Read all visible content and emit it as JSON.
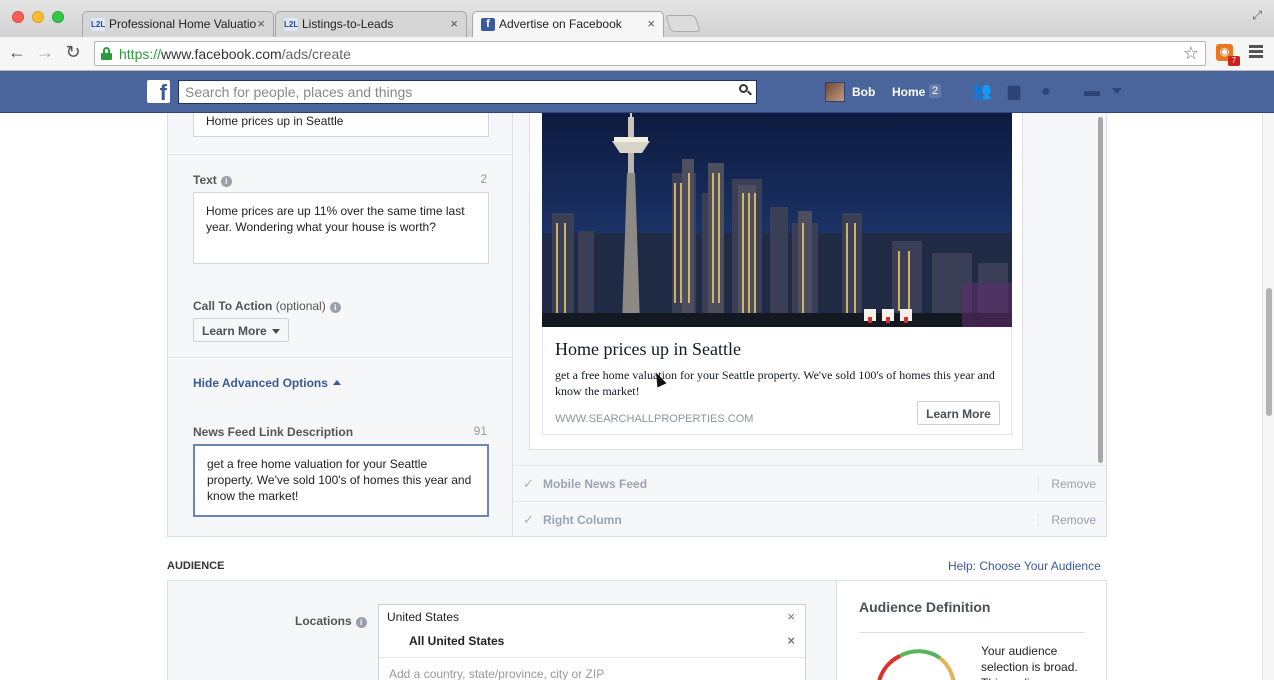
{
  "browser": {
    "tabs": [
      {
        "label": "Professional Home Valuatio",
        "favicon": "L2L",
        "active": false
      },
      {
        "label": "Listings-to-Leads",
        "favicon": "L2L",
        "active": false
      },
      {
        "label": "Advertise on Facebook",
        "favicon": "f",
        "active": true
      }
    ],
    "close_glyph": "×",
    "url_scheme": "https://",
    "url_host": "www.facebook.com",
    "url_path": "/ads/create",
    "rss_badge": "7"
  },
  "fb_header": {
    "logo": "f",
    "search_placeholder": "Search for people, places and things",
    "user_name": "Bob",
    "home_label": "Home",
    "home_count": "2",
    "brand_color": "#4a649c"
  },
  "ad_form": {
    "headline_value": "Home prices up in Seattle",
    "text_label": "Text",
    "text_count": "2",
    "text_value": "Home prices are up 11% over the same time last year. Wondering what your house is worth?",
    "cta_label": "Call To Action",
    "cta_optional": "(optional)",
    "cta_value": "Learn More",
    "advanced_toggle": "Hide Advanced Options",
    "news_feed_label": "News Feed Link Description",
    "news_feed_count": "91",
    "news_feed_value": "get a free home valuation for your Seattle property. We've sold 100's of homes this year and know the market!"
  },
  "preview": {
    "headline": "Home prices up in Seattle",
    "description": "get a free home valuation for your Seattle property. We've sold 100's of homes this year and know the market!",
    "domain": "WWW.SEARCHALLPROPERTIES.COM",
    "button": "Learn More",
    "placements": [
      {
        "name": "Mobile News Feed",
        "action": "Remove"
      },
      {
        "name": "Right Column",
        "action": "Remove"
      }
    ]
  },
  "audience": {
    "section_title": "AUDIENCE",
    "help_link": "Help: Choose Your Audience",
    "locations_label": "Locations",
    "location_country": "United States",
    "location_scope": "All United States",
    "location_placeholder": "Add a country, state/province, city or ZIP",
    "definition_title": "Audience Definition",
    "definition_text": "Your audience selection is broad. This audience"
  }
}
